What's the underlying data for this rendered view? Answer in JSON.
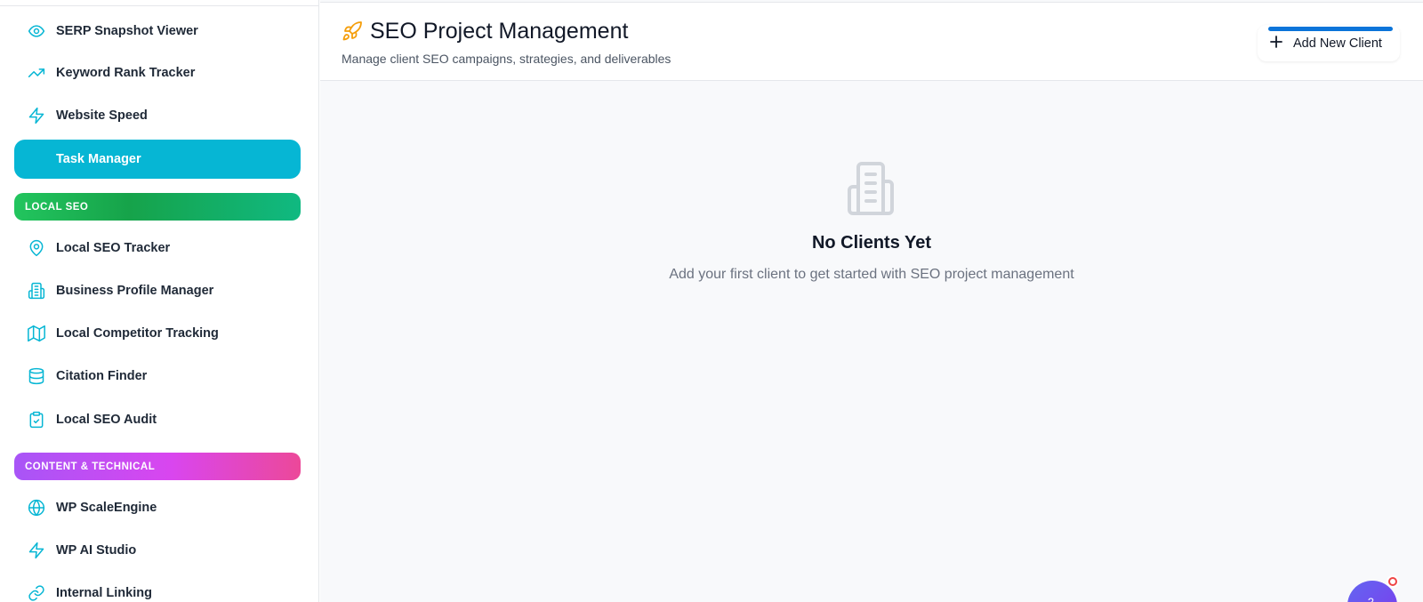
{
  "sidebar": {
    "items_top": [
      {
        "label": "SERP Snapshot Viewer",
        "icon": "eye-icon"
      },
      {
        "label": "Keyword Rank Tracker",
        "icon": "trending-up-icon"
      },
      {
        "label": "Website Speed",
        "icon": "lightning-icon"
      },
      {
        "label": "Task Manager",
        "icon": "none",
        "active": true
      }
    ],
    "section_local": "LOCAL SEO",
    "items_local": [
      {
        "label": "Local SEO Tracker",
        "icon": "map-pin-icon"
      },
      {
        "label": "Business Profile Manager",
        "icon": "building-icon"
      },
      {
        "label": "Local Competitor Tracking",
        "icon": "map-icon"
      },
      {
        "label": "Citation Finder",
        "icon": "database-icon"
      },
      {
        "label": "Local SEO Audit",
        "icon": "clipboard-check-icon"
      }
    ],
    "section_content": "CONTENT & TECHNICAL",
    "items_content": [
      {
        "label": "WP ScaleEngine",
        "icon": "globe-icon"
      },
      {
        "label": "WP AI Studio",
        "icon": "lightning-icon"
      },
      {
        "label": "Internal Linking",
        "icon": "link-icon"
      }
    ]
  },
  "header": {
    "title": "SEO Project Management",
    "subtitle": "Manage client SEO campaigns, strategies, and deliverables",
    "add_button": "Add New Client"
  },
  "empty_state": {
    "title": "No Clients Yet",
    "text": "Add your first client to get started with SEO project management"
  },
  "fab": {
    "glyph": "?"
  },
  "colors": {
    "accent": "#06b6d4",
    "active_bg": "#06b6d4",
    "local_seo_gradient": [
      "#22c55e",
      "#10b981"
    ],
    "content_gradient": [
      "#a855f7",
      "#ec4899"
    ],
    "rocket": "#f59e0b",
    "button_bar": "#0b74d9"
  }
}
